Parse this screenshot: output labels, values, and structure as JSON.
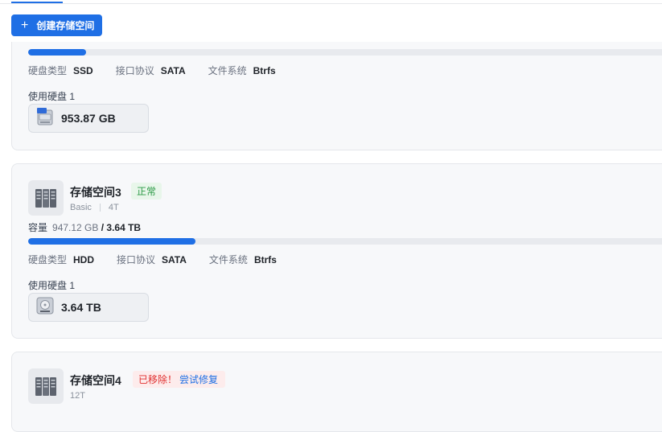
{
  "toolbar": {
    "create_label": "创建存储空间",
    "create_icon": "plus-icon"
  },
  "pools": [
    {
      "usage_fraction": 0.09,
      "disk_type_key": "硬盘类型",
      "disk_type": "SSD",
      "protocol_key": "接口协议",
      "protocol": "SATA",
      "fs_key": "文件系统",
      "fs": "Btrfs",
      "disks_label": "使用硬盘 1",
      "disk_size": "953.87 GB",
      "disk_icon": "ssd-icon"
    },
    {
      "name": "存储空间3",
      "status": "正常",
      "mode": "Basic",
      "size_tag": "4T",
      "capacity_label": "容量",
      "capacity_used": "947.12 GB",
      "capacity_total": "/ 3.64 TB",
      "usage_fraction": 0.26,
      "disk_type_key": "硬盘类型",
      "disk_type": "HDD",
      "protocol_key": "接口协议",
      "protocol": "SATA",
      "fs_key": "文件系统",
      "fs": "Btrfs",
      "disks_label": "使用硬盘 1",
      "disk_size": "3.64 TB",
      "disk_icon": "hdd-icon"
    },
    {
      "name": "存储空间4",
      "status": "已移除！",
      "retry_label": "尝试修复",
      "size_tag": "12T"
    }
  ],
  "colors": {
    "accent": "#1f6fe5",
    "ok": "#2e9b48",
    "error": "#e02f2f"
  }
}
